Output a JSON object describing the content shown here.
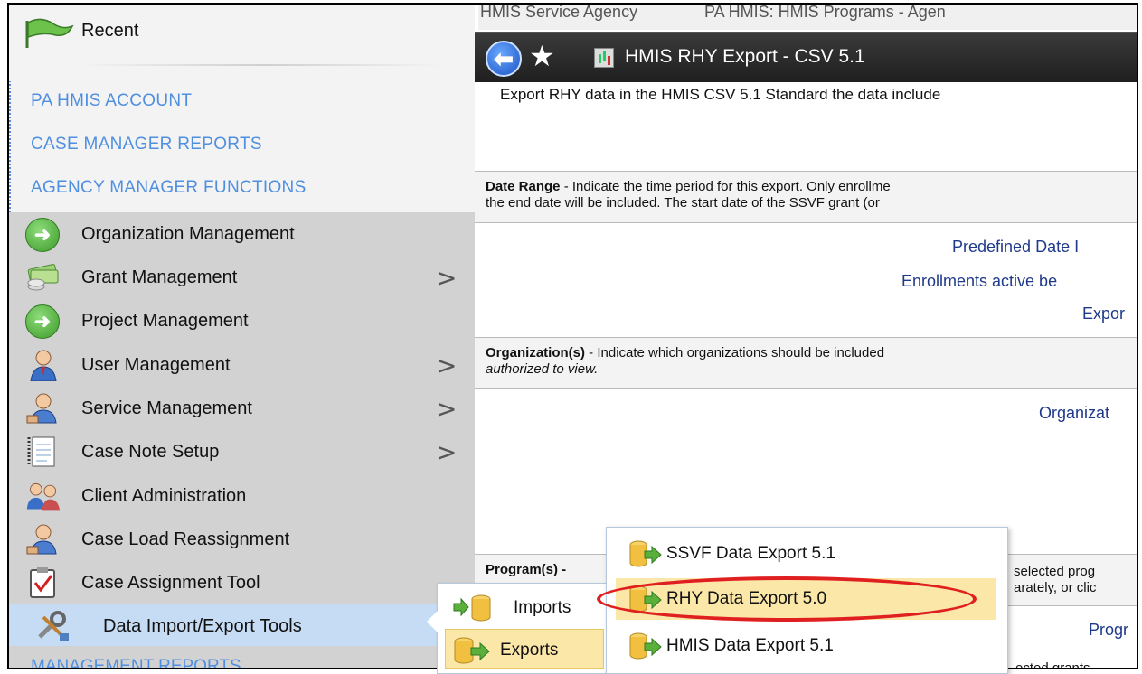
{
  "sidebar": {
    "recent_label": "Recent",
    "section_links": [
      "PA HMIS ACCOUNT",
      "CASE MANAGER REPORTS",
      "AGENCY MANAGER FUNCTIONS"
    ],
    "menu": [
      {
        "label": "Organization Management",
        "icon": "green-arrow-icon",
        "has_submenu": false
      },
      {
        "label": "Grant Management",
        "icon": "money-icon",
        "has_submenu": true
      },
      {
        "label": "Project Management",
        "icon": "green-arrow-icon",
        "has_submenu": false
      },
      {
        "label": "User Management",
        "icon": "user-icon",
        "has_submenu": true
      },
      {
        "label": "Service Management",
        "icon": "service-user-icon",
        "has_submenu": true
      },
      {
        "label": "Case Note Setup",
        "icon": "notepad-icon",
        "has_submenu": true
      },
      {
        "label": "Client Administration",
        "icon": "users-icon",
        "has_submenu": false
      },
      {
        "label": "Case Load Reassignment",
        "icon": "service-user-icon",
        "has_submenu": false
      },
      {
        "label": "Case Assignment Tool",
        "icon": "clipboard-check-icon",
        "has_submenu": false
      },
      {
        "label": "Data Import/Export Tools",
        "icon": "tools-icon",
        "has_submenu": false
      }
    ],
    "bottom_link": "MANAGEMENT REPORTS"
  },
  "main": {
    "breadcrumb_left": "HMIS Service Agency",
    "breadcrumb_right": "PA HMIS: HMIS Programs - Agen",
    "title": "HMIS RHY Export - CSV 5.1",
    "description": "Export RHY data in the HMIS CSV 5.1 Standard the data include",
    "date_range_bold": "Date Range",
    "date_range_line1": " - Indicate the time period for this export. Only enrollme",
    "date_range_line2": "the end date will be included. The start date of the SSVF grant (or",
    "predefined_date": "Predefined Date I",
    "enrollments_active": "Enrollments active be",
    "export_label": "Expor",
    "organizations_bold": "Organization(s)",
    "organizations_line1": " - Indicate which organizations should be included",
    "organizations_line2": "authorized to view.",
    "organization_field": "Organizat",
    "programs_bold": "Program(s) -",
    "programs_right1": "selected prog",
    "programs_right2": "arately, or clic",
    "programs_field": "Progr",
    "grants_text": "ected grants."
  },
  "flyout_import_export": {
    "items": [
      "Imports",
      "Exports"
    ]
  },
  "flyout_exports": {
    "items": [
      "SSVF Data Export 5.1",
      "RHY Data Export 5.0",
      "HMIS Data Export 5.1"
    ],
    "highlighted": "RHY Data Export 5.0"
  },
  "colors": {
    "link_blue": "#4f8fe0",
    "highlight_yellow": "#fbe7a8",
    "annotation_red": "#e02020"
  }
}
